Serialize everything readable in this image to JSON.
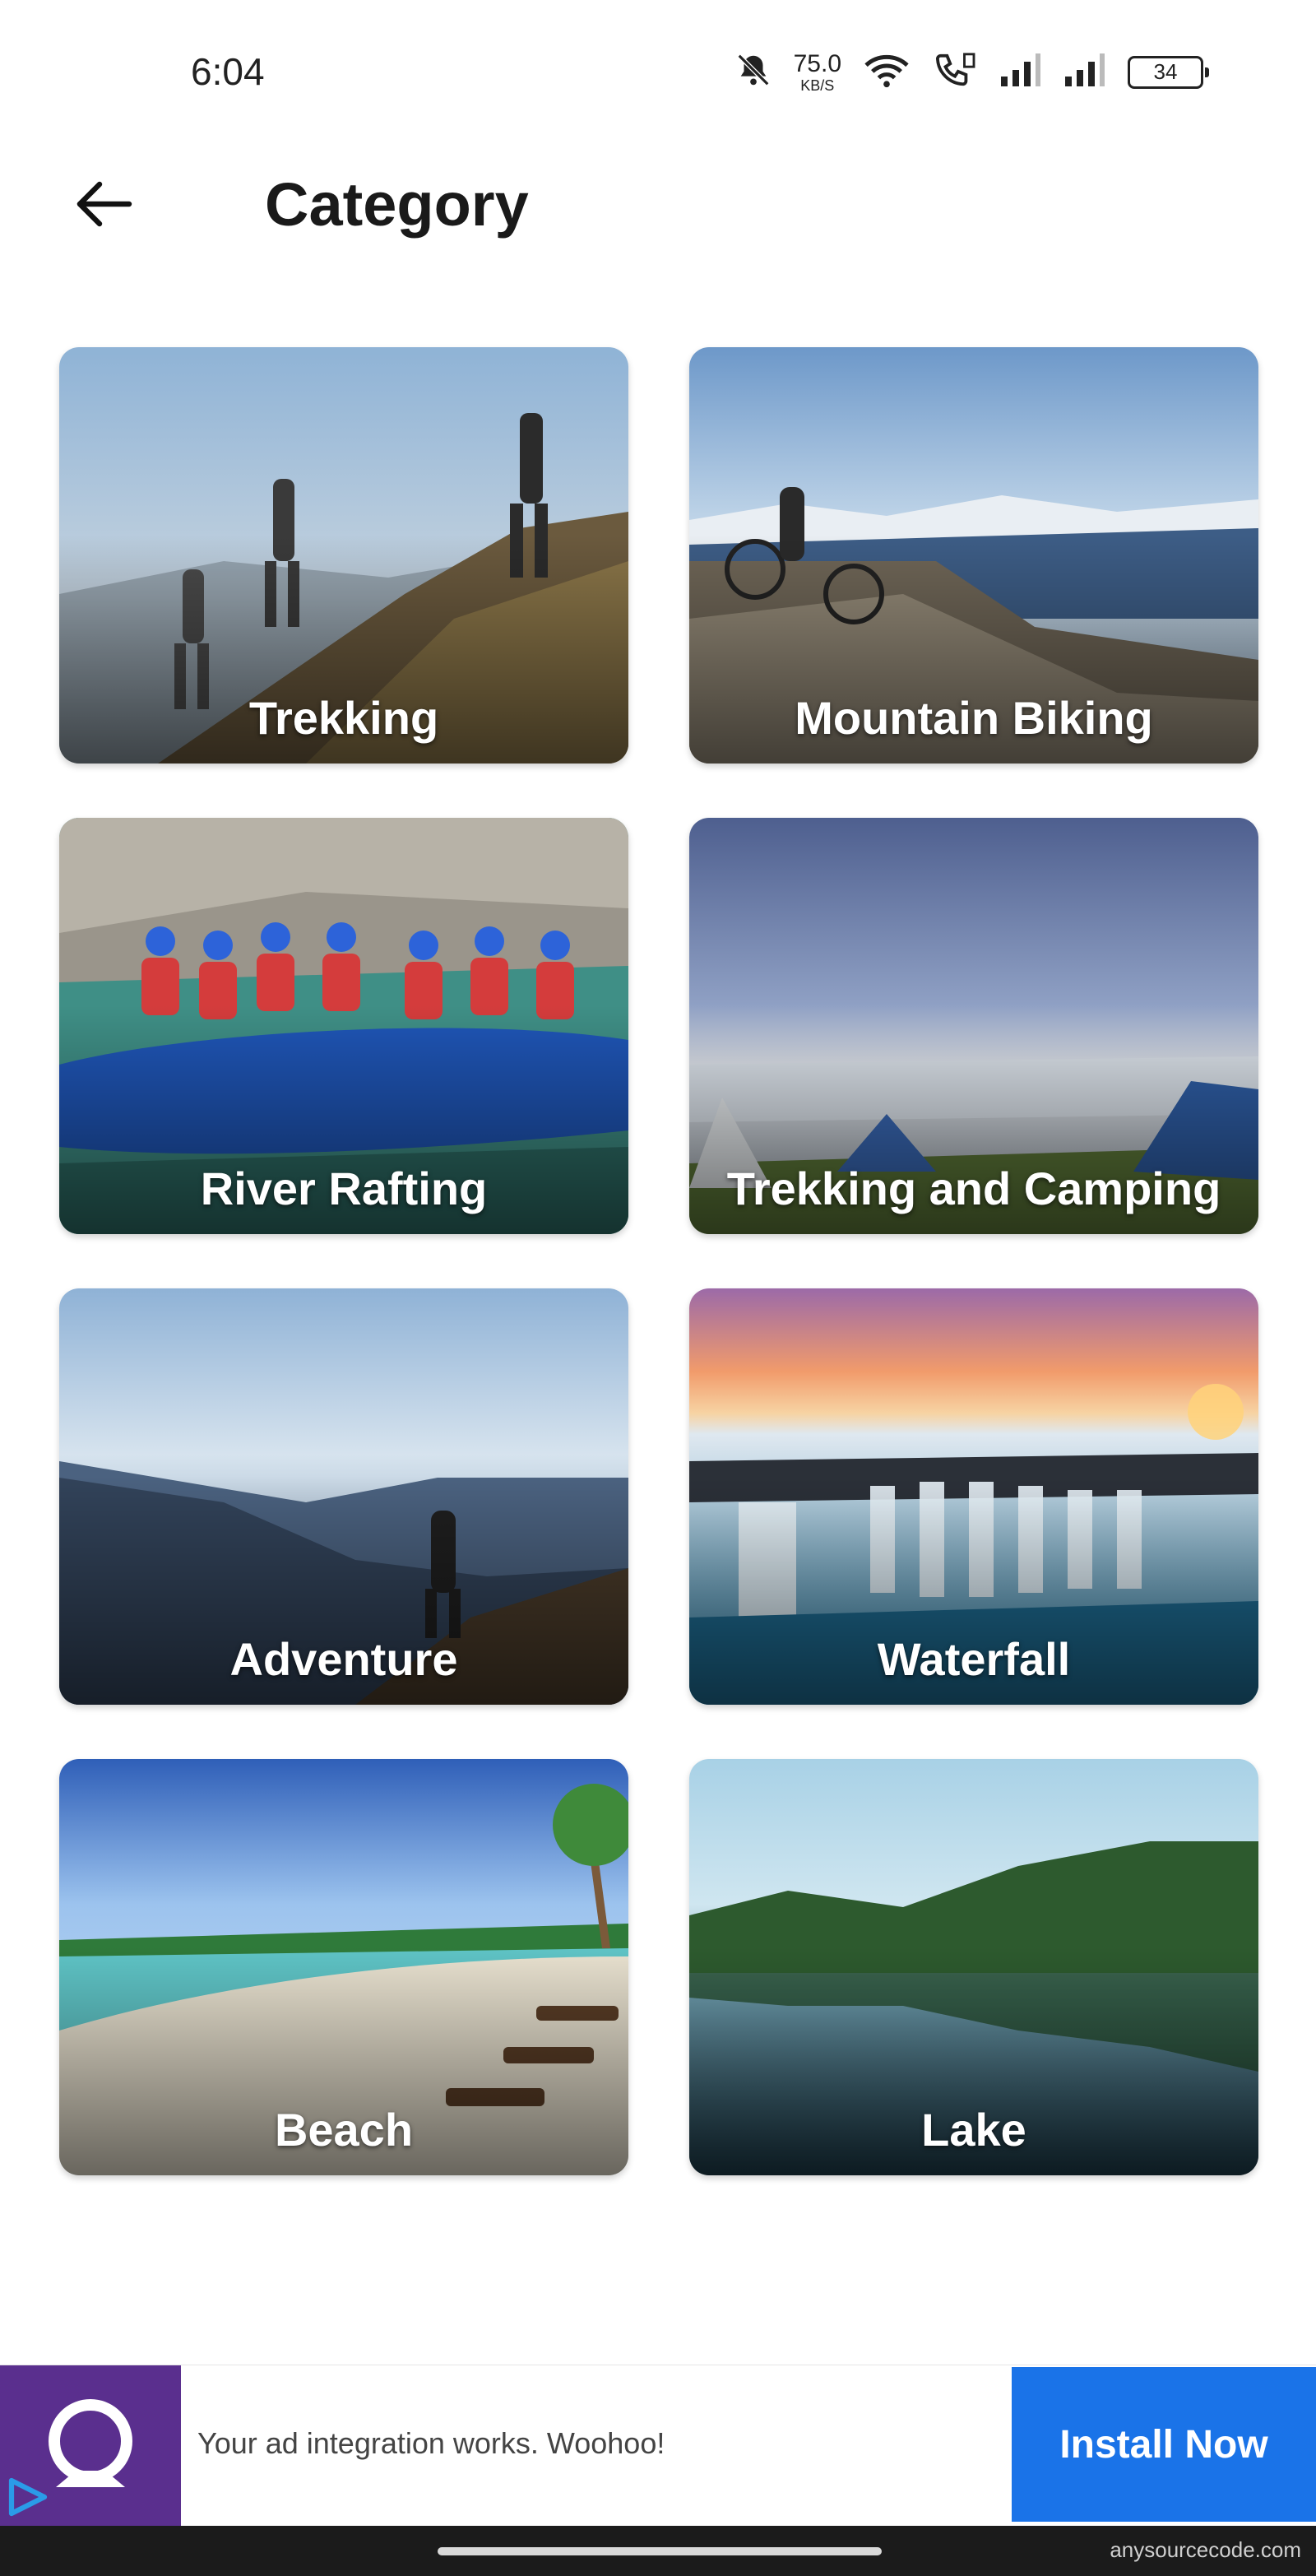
{
  "status_bar": {
    "time": "6:04",
    "net_speed_value": "75.0",
    "net_speed_unit": "KB/S",
    "battery": "34",
    "icons": [
      "bell-muted-icon",
      "wifi-icon",
      "call-volte-icon",
      "signal-icon",
      "signal-icon"
    ]
  },
  "header": {
    "title": "Category",
    "back_icon": "arrow-left-icon"
  },
  "categories": [
    {
      "label": "Trekking"
    },
    {
      "label": "Mountain Biking"
    },
    {
      "label": "River Rafting"
    },
    {
      "label": "Trekking and Camping"
    },
    {
      "label": "Adventure"
    },
    {
      "label": "Waterfall"
    },
    {
      "label": "Beach"
    },
    {
      "label": "Lake"
    }
  ],
  "ad": {
    "text": "Your ad integration works. Woohoo!",
    "button_label": "Install Now",
    "colors": {
      "logo_bg": "#5a2f8e",
      "button_bg": "#1a73e8"
    }
  },
  "footer": {
    "watermark": "anysourcecode.com"
  }
}
